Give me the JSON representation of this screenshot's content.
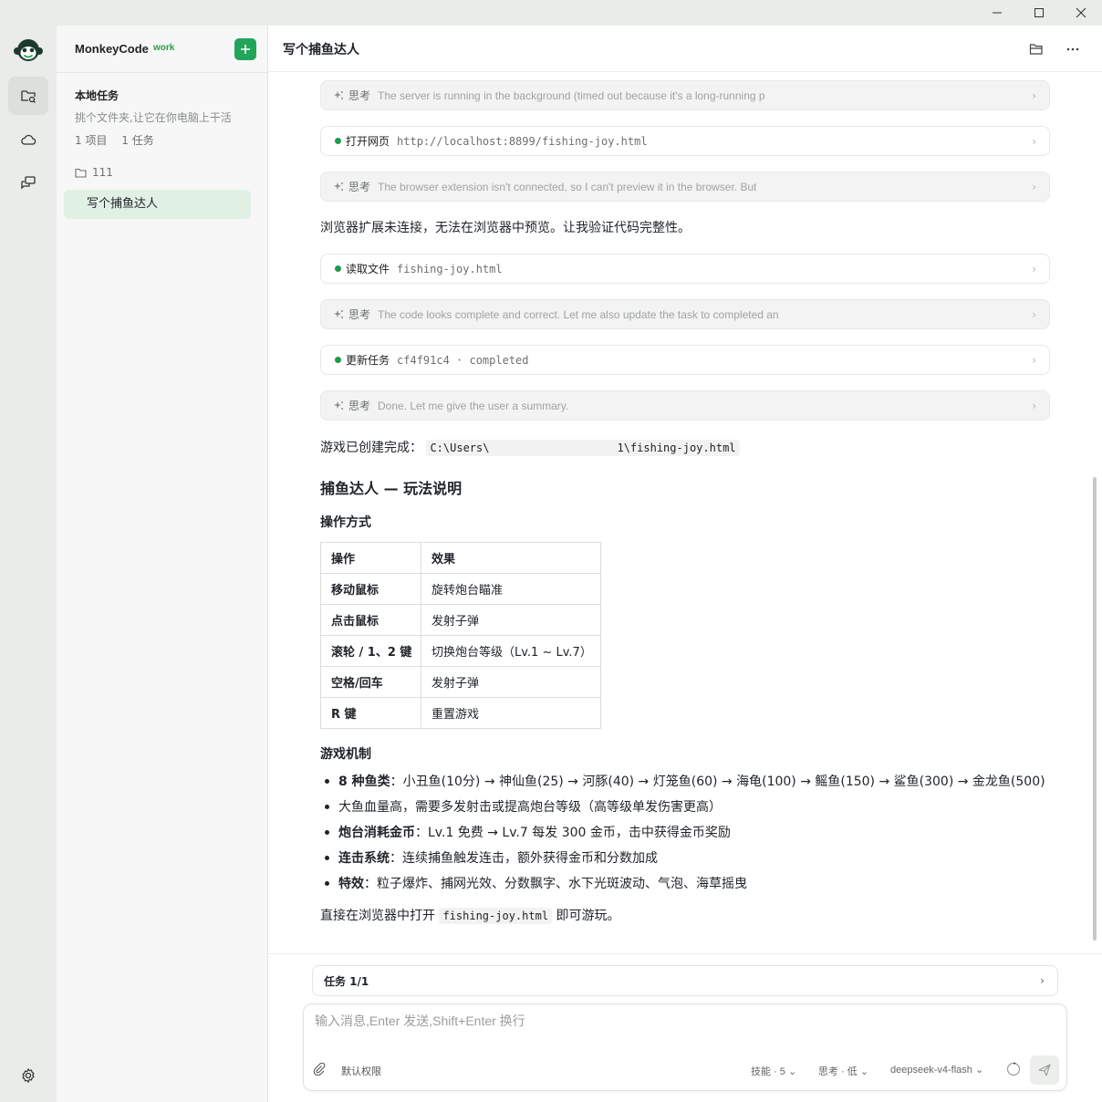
{
  "window": {
    "minimize": "—",
    "maximize": "☐",
    "close": "✕"
  },
  "sidebar": {
    "brand": "MonkeyCode",
    "brand_tag": "work",
    "section_title": "本地任务",
    "section_sub": "挑个文件夹,让它在你电脑上干活",
    "stats_projects": "1 项目",
    "stats_tasks": "1 任务",
    "folder": "111",
    "active_task": "写个捕鱼达人"
  },
  "header": {
    "title": "写个捕鱼达人"
  },
  "steps": [
    {
      "kind": "think",
      "label": "思考",
      "text": "The server is running in the background (timed out because it's a long-running p"
    },
    {
      "kind": "tool",
      "label": "打开网页",
      "text": "http://localhost:8899/fishing-joy.html"
    },
    {
      "kind": "think",
      "label": "思考",
      "text": "The browser extension isn't connected, so I can't preview it in the browser. But"
    },
    {
      "kind": "tool",
      "label": "读取文件",
      "text": "fishing-joy.html"
    },
    {
      "kind": "think",
      "label": "思考",
      "text": "The code looks complete and correct. Let me also update the task to completed an"
    },
    {
      "kind": "tool",
      "label": "更新任务",
      "text": "cf4f91c4 · completed"
    },
    {
      "kind": "think",
      "label": "思考",
      "text": "Done. Let me give the user a summary."
    }
  ],
  "message": {
    "browser_note": "浏览器扩展未连接，无法在浏览器中预览。让我验证代码完整性。",
    "created_prefix": "游戏已创建完成：",
    "path_start": "C:\\Users\\",
    "path_end": "1\\fishing-joy.html",
    "h2": "捕鱼达人 — 玩法说明",
    "ops_title": "操作方式",
    "table": {
      "headers": [
        "操作",
        "效果"
      ],
      "rows": [
        [
          "移动鼠标",
          "旋转炮台瞄准"
        ],
        [
          "点击鼠标",
          "发射子弹"
        ],
        [
          "滚轮 / 1、2 键",
          "切换炮台等级（Lv.1 ~ Lv.7）"
        ],
        [
          "空格/回车",
          "发射子弹"
        ],
        [
          "R 键",
          "重置游戏"
        ]
      ]
    },
    "mech_title": "游戏机制",
    "mech": [
      {
        "bold": "8 种鱼类",
        "text": "：小丑鱼(10分) → 神仙鱼(25) → 河豚(40) → 灯笼鱼(60) → 海龟(100) → 鳐鱼(150) → 鲨鱼(300) → 金龙鱼(500)"
      },
      {
        "bold": "",
        "text": "大鱼血量高，需要多发射击或提高炮台等级（高等级单发伤害更高）"
      },
      {
        "bold": "炮台消耗金币",
        "text": "：Lv.1 免费 → Lv.7 每发 300 金币，击中获得金币奖励"
      },
      {
        "bold": "连击系统",
        "text": "：连续捕鱼触发连击，额外获得金币和分数加成"
      },
      {
        "bold": "特效",
        "text": "：粒子爆炸、捕网光效、分数飘字、水下光斑波动、气泡、海草摇曳"
      }
    ],
    "closing_pre": "直接在浏览器中打开 ",
    "closing_code": "fishing-joy.html",
    "closing_post": " 即可游玩。"
  },
  "footer": {
    "task_label": "任务 1/1",
    "input_placeholder": "输入消息,Enter 发送,Shift+Enter 换行",
    "permission": "默认权限",
    "skills": "技能 · 5",
    "thinking": "思考 · 低",
    "model": "deepseek-v4-flash"
  },
  "colors": {
    "accent": "#22a55a",
    "active_bg": "#e1f0e4",
    "tool_dot": "#1f9a4c"
  }
}
